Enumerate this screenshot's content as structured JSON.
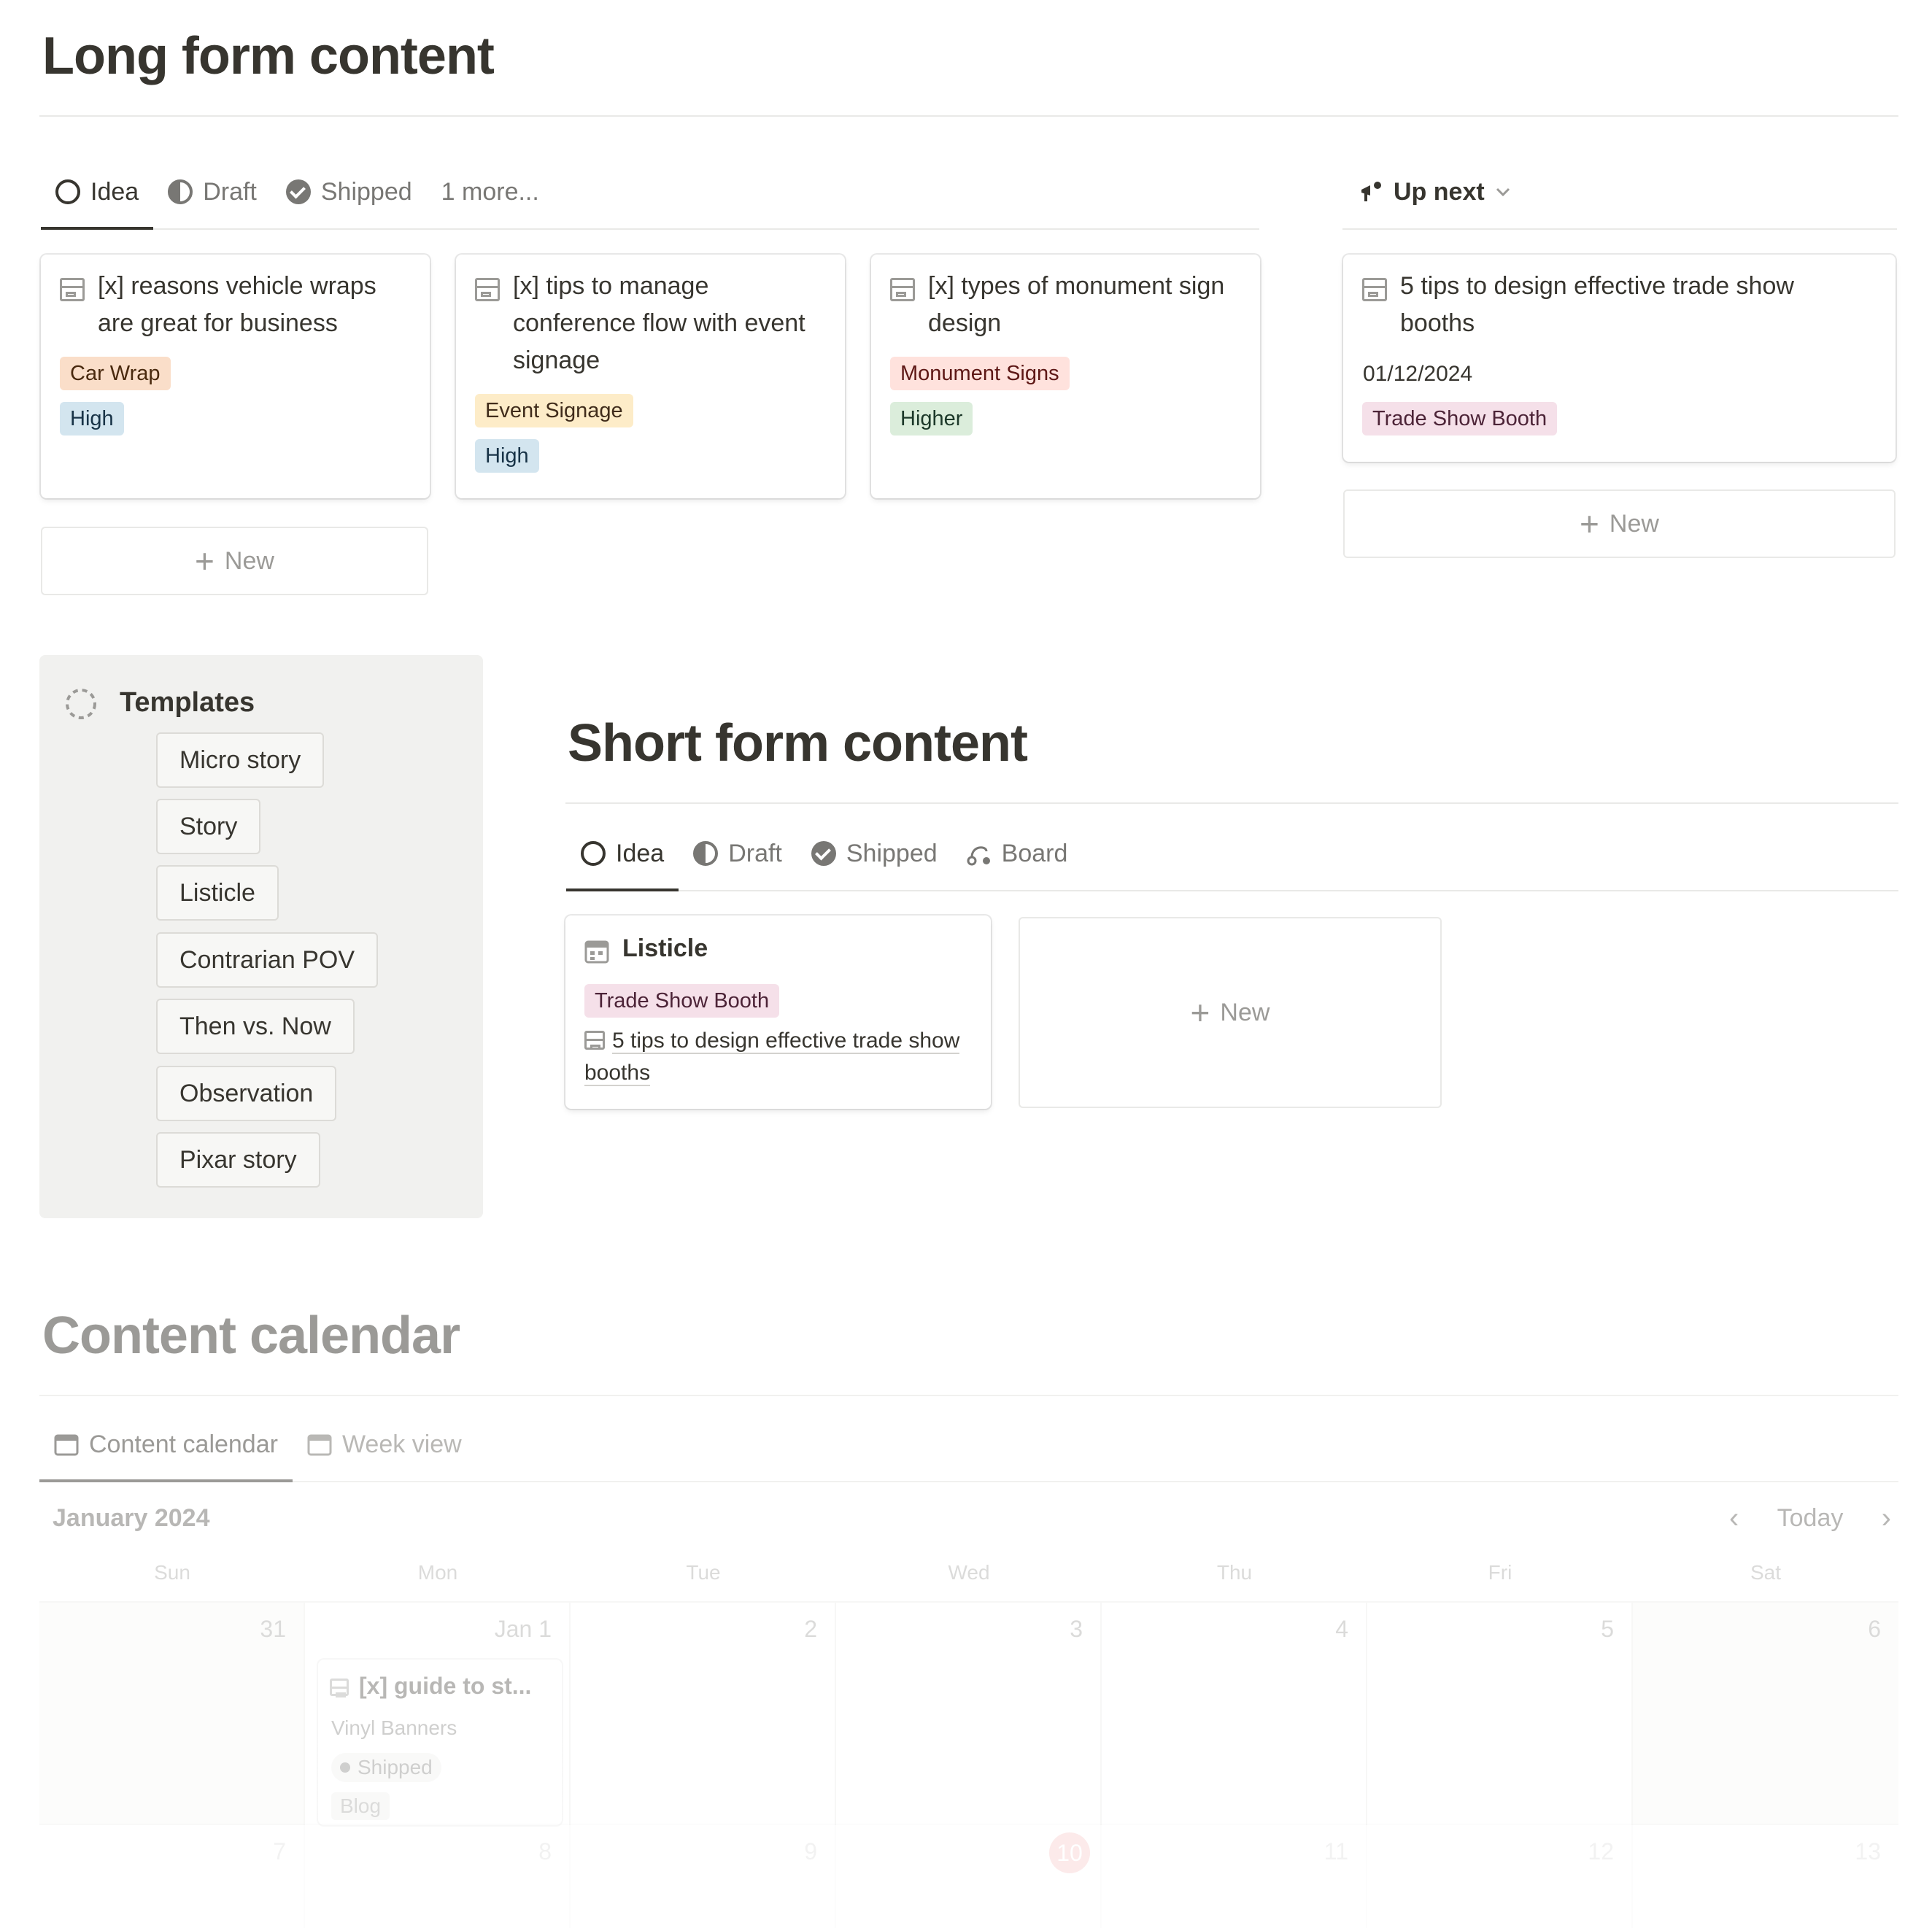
{
  "long_form": {
    "title": "Long form content",
    "tabs": [
      {
        "label": "Idea",
        "icon": "circle-icon"
      },
      {
        "label": "Draft",
        "icon": "half-circle-icon"
      },
      {
        "label": "Shipped",
        "icon": "check-circle-icon"
      },
      {
        "label": "1 more..."
      }
    ],
    "cards": [
      {
        "title": "[x] reasons vehicle wraps are great for business",
        "tags": [
          {
            "label": "Car Wrap",
            "color": "#fadec9"
          },
          {
            "label": "High",
            "color": "#d3e5ef"
          }
        ]
      },
      {
        "title": "[x] tips to manage conference flow with event signage",
        "tags": [
          {
            "label": "Event Signage",
            "color": "#fdecc8"
          },
          {
            "label": "High",
            "color": "#d3e5ef"
          }
        ]
      },
      {
        "title": "[x] types of monument sign design",
        "tags": [
          {
            "label": "Monument Signs",
            "color": "#ffe2dd"
          },
          {
            "label": "Higher",
            "color": "#dbeddb"
          }
        ]
      }
    ],
    "new_label": "New"
  },
  "up_next": {
    "label": "Up next",
    "card": {
      "title": "5 tips to design effective trade show booths",
      "date": "01/12/2024",
      "tag": {
        "label": "Trade Show Booth",
        "color": "#f5e0e9"
      }
    },
    "new_label": "New"
  },
  "templates": {
    "title": "Templates",
    "items": [
      "Micro story",
      "Story",
      "Listicle",
      "Contrarian POV",
      "Then vs. Now",
      "Observation",
      "Pixar story"
    ]
  },
  "short_form": {
    "title": "Short form content",
    "tabs": [
      {
        "label": "Idea",
        "icon": "circle-icon"
      },
      {
        "label": "Draft",
        "icon": "half-circle-icon"
      },
      {
        "label": "Shipped",
        "icon": "check-circle-icon"
      },
      {
        "label": "Board",
        "icon": "board-icon"
      }
    ],
    "card": {
      "title": "Listicle",
      "tag": {
        "label": "Trade Show Booth",
        "color": "#f5e0e9"
      },
      "relation": "5 tips to design effective trade show booths"
    },
    "new_label": "New"
  },
  "calendar": {
    "title": "Content calendar",
    "tabs": [
      {
        "label": "Content calendar",
        "icon": "calendar-icon"
      },
      {
        "label": "Week view",
        "icon": "calendar-icon"
      }
    ],
    "month": "January 2024",
    "today_label": "Today",
    "weekdays": [
      "Sun",
      "Mon",
      "Tue",
      "Wed",
      "Thu",
      "Fri",
      "Sat"
    ],
    "week1": [
      "31",
      "Jan 1",
      "2",
      "3",
      "4",
      "5",
      "6"
    ],
    "week2": [
      "7",
      "8",
      "9",
      "10",
      "11",
      "12",
      "13"
    ],
    "event": {
      "title": "[x] guide to st...",
      "tag1": "Vinyl Banners",
      "status": "Shipped",
      "tag2": "Blog"
    }
  }
}
